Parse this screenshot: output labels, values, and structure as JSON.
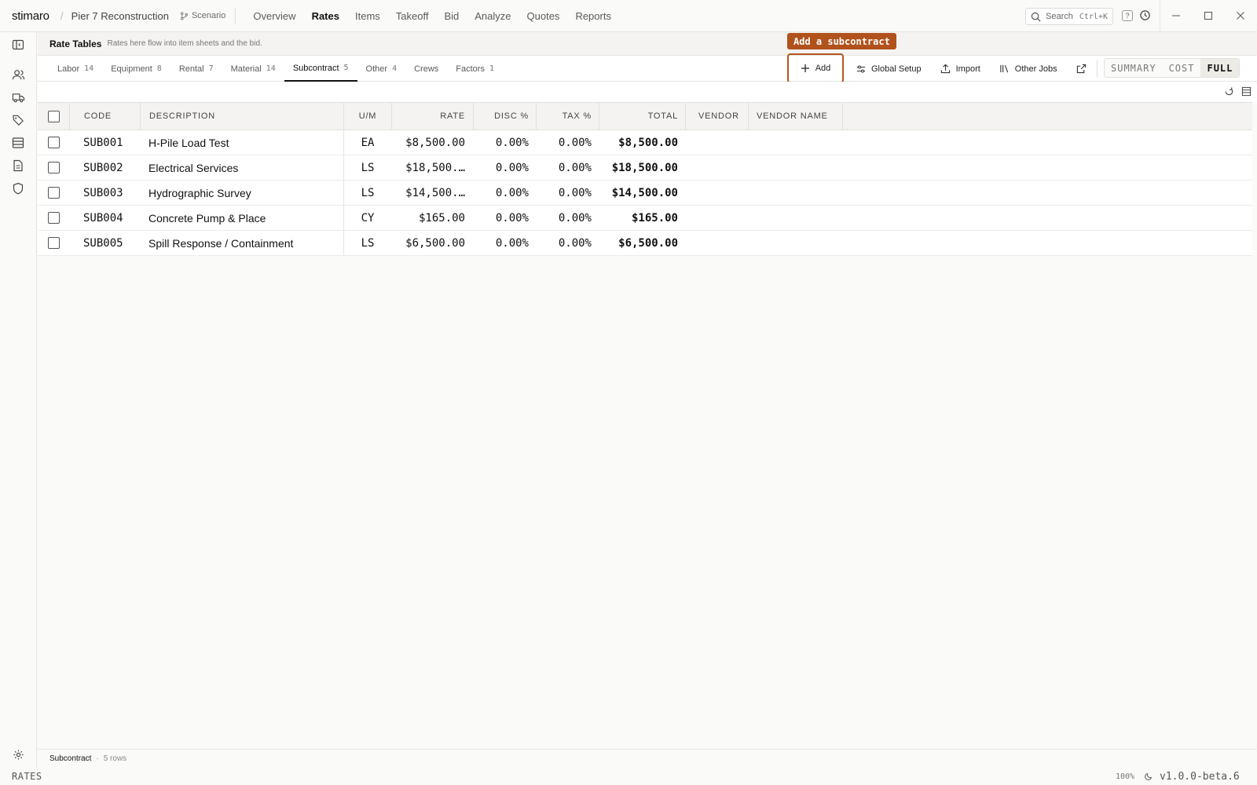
{
  "app": {
    "brand": "stimaro",
    "separator": "/",
    "project": "Pier 7 Reconstruction",
    "scenario": "Scenario",
    "nav": [
      "Overview",
      "Rates",
      "Items",
      "Takeoff",
      "Bid",
      "Analyze",
      "Quotes",
      "Reports"
    ],
    "active_nav": "Rates",
    "search_label": "Search",
    "search_shortcut": "Ctrl+K",
    "help_label": "?"
  },
  "rate_tables": {
    "title": "Rate Tables",
    "subtitle": "Rates here flow into item sheets and the bid."
  },
  "tabs": [
    {
      "label": "Labor",
      "count": "14"
    },
    {
      "label": "Equipment",
      "count": "8"
    },
    {
      "label": "Rental",
      "count": "7"
    },
    {
      "label": "Material",
      "count": "14"
    },
    {
      "label": "Subcontract",
      "count": "5",
      "active": true
    },
    {
      "label": "Other",
      "count": "4"
    },
    {
      "label": "Crews",
      "count": ""
    },
    {
      "label": "Factors",
      "count": "1"
    }
  ],
  "toolbar": {
    "add_label": "Add",
    "tooltip": "Add a subcontract",
    "global_setup_label": "Global Setup",
    "import_label": "Import",
    "other_jobs_label": "Other Jobs"
  },
  "view_modes": [
    "SUMMARY",
    "COST",
    "FULL"
  ],
  "active_view": "FULL",
  "table": {
    "headers": {
      "code": "CODE",
      "description": "DESCRIPTION",
      "um": "U/M",
      "rate": "RATE",
      "disc": "DISC %",
      "tax": "TAX %",
      "total": "TOTAL",
      "vendor": "VENDOR",
      "vendor_name": "VENDOR NAME"
    },
    "rows": [
      {
        "code": "SUB001",
        "description": "H-Pile Load Test",
        "um": "EA",
        "rate": "$8,500.00",
        "disc": "0.00%",
        "tax": "0.00%",
        "total": "$8,500.00",
        "vendor": "",
        "vendor_name": ""
      },
      {
        "code": "SUB002",
        "description": "Electrical Services",
        "um": "LS",
        "rate": "$18,500.…",
        "disc": "0.00%",
        "tax": "0.00%",
        "total": "$18,500.00",
        "vendor": "",
        "vendor_name": ""
      },
      {
        "code": "SUB003",
        "description": "Hydrographic Survey",
        "um": "LS",
        "rate": "$14,500.…",
        "disc": "0.00%",
        "tax": "0.00%",
        "total": "$14,500.00",
        "vendor": "",
        "vendor_name": ""
      },
      {
        "code": "SUB004",
        "description": "Concrete Pump & Place",
        "um": "CY",
        "rate": "$165.00",
        "disc": "0.00%",
        "tax": "0.00%",
        "total": "$165.00",
        "vendor": "",
        "vendor_name": ""
      },
      {
        "code": "SUB005",
        "description": "Spill Response / Containment",
        "um": "LS",
        "rate": "$6,500.00",
        "disc": "0.00%",
        "tax": "0.00%",
        "total": "$6,500.00",
        "vendor": "",
        "vendor_name": ""
      }
    ]
  },
  "footer": {
    "section": "Subcontract",
    "dot": "·",
    "rows": "5 rows"
  },
  "status": {
    "mode": "RATES",
    "zoom": "100%",
    "version": "v1.0.0-beta.6"
  },
  "colors": {
    "accent": "#b1521c",
    "background": "#fafaf9"
  },
  "icons": {
    "rail": [
      "sidebar-toggle-icon",
      "users-icon",
      "truck-icon",
      "tags-icon",
      "database-icon",
      "document-icon",
      "shield-icon",
      "settings-icon"
    ]
  }
}
